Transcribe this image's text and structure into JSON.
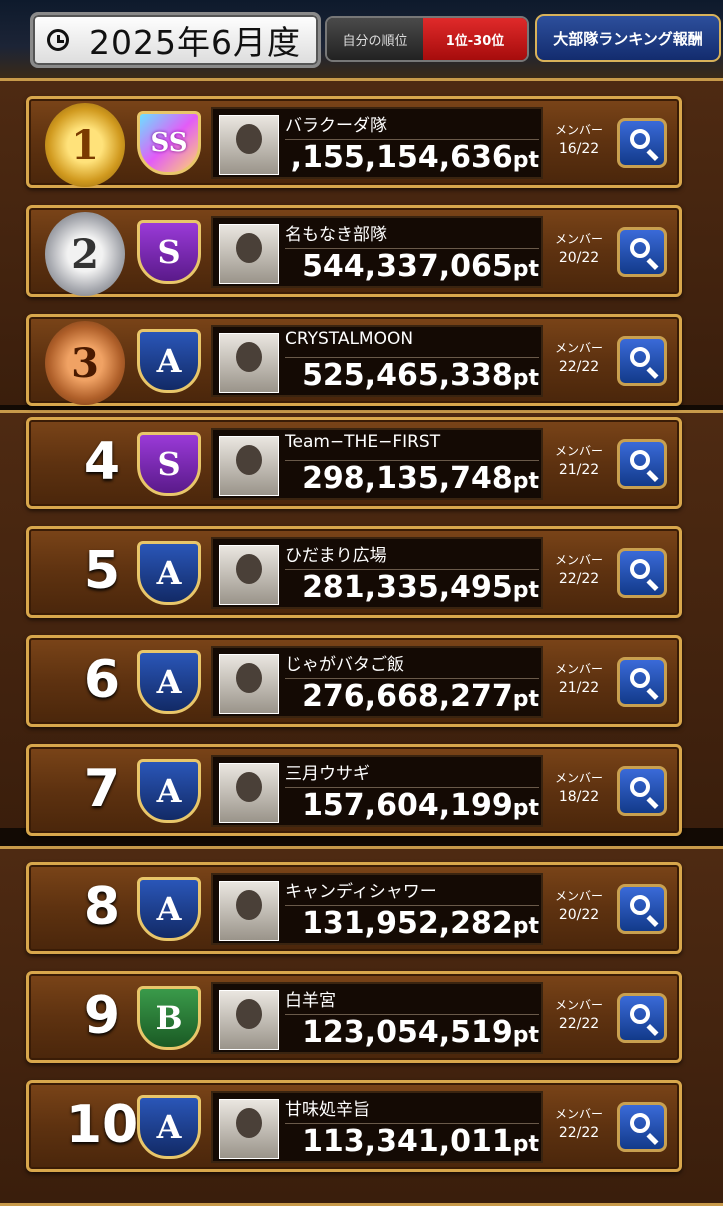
{
  "header": {
    "month": "2025年6月度",
    "own_rank_label": "自分の順位",
    "range_label": "1位-30位",
    "reward_button": "大部隊ランキング報酬"
  },
  "labels": {
    "members": "メンバー",
    "pt_suffix": "pt"
  },
  "rows": [
    {
      "rank": "1",
      "medal": "1",
      "medal_type": "gold",
      "crest": "SS",
      "name": "バラクーダ隊",
      "points": ",155,154,636",
      "members": "16/22"
    },
    {
      "rank": "2",
      "medal": "2",
      "medal_type": "silver",
      "crest": "S",
      "name": "名もなき部隊",
      "points": "544,337,065",
      "members": "20/22"
    },
    {
      "rank": "3",
      "medal": "3",
      "medal_type": "bronze",
      "crest": "A",
      "name": "CRYSTALMOON",
      "points": "525,465,338",
      "members": "22/22"
    },
    {
      "rank": "4",
      "crest": "S",
      "name": "Team−THE−FIRST",
      "points": "298,135,748",
      "members": "21/22"
    },
    {
      "rank": "5",
      "crest": "A",
      "name": "ひだまり広場",
      "points": "281,335,495",
      "members": "22/22"
    },
    {
      "rank": "6",
      "crest": "A",
      "name": "じゃがバタご飯",
      "points": "276,668,277",
      "members": "21/22"
    },
    {
      "rank": "7",
      "crest": "A",
      "name": "三月ウサギ",
      "points": "157,604,199",
      "members": "18/22"
    },
    {
      "rank": "8",
      "crest": "A",
      "name": "キャンディシャワー",
      "points": "131,952,282",
      "members": "20/22"
    },
    {
      "rank": "9",
      "crest": "B",
      "name": "白羊宮",
      "points": "123,054,519",
      "members": "22/22"
    },
    {
      "rank": "10",
      "crest": "A",
      "name": "甘味処辛旨",
      "points": "113,341,011",
      "members": "22/22"
    }
  ]
}
